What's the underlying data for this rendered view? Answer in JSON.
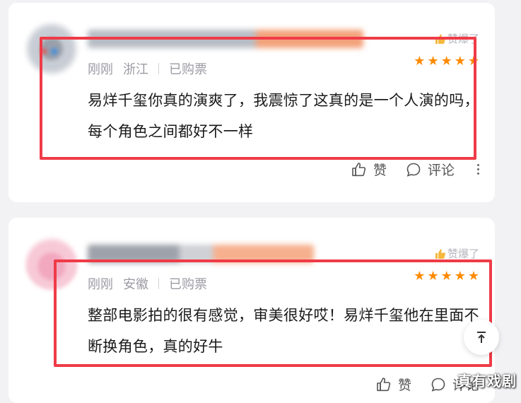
{
  "reviews": [
    {
      "time": "刚刚",
      "location": "浙江",
      "purchase": "已购票",
      "hot_label": "赞爆了",
      "rating": 5,
      "content": "易烊千玺你真的演爽了，我震惊了这真的是一个人演的吗，每个角色之间都好不一样",
      "like_label": "赞",
      "comment_label": "评论"
    },
    {
      "time": "刚刚",
      "location": "安徽",
      "purchase": "已购票",
      "hot_label": "赞爆了",
      "rating": 5,
      "content": "整部电影拍的很有感觉，审美很好哎！易烊千玺他在里面不断换角色，真的好牛",
      "like_label": "赞",
      "comment_label": "评论"
    }
  ],
  "watermark": "真有戏剧",
  "colors": {
    "accent_red": "#ef3b47",
    "star_orange": "#ff8a00",
    "meta_gray": "#9b9ba3"
  },
  "icons": {
    "like": "thumbs-up-icon",
    "comment": "comment-bubble-icon",
    "more": "more-vertical-icon",
    "back_to_top": "arrow-up-icon",
    "star": "star-icon"
  }
}
